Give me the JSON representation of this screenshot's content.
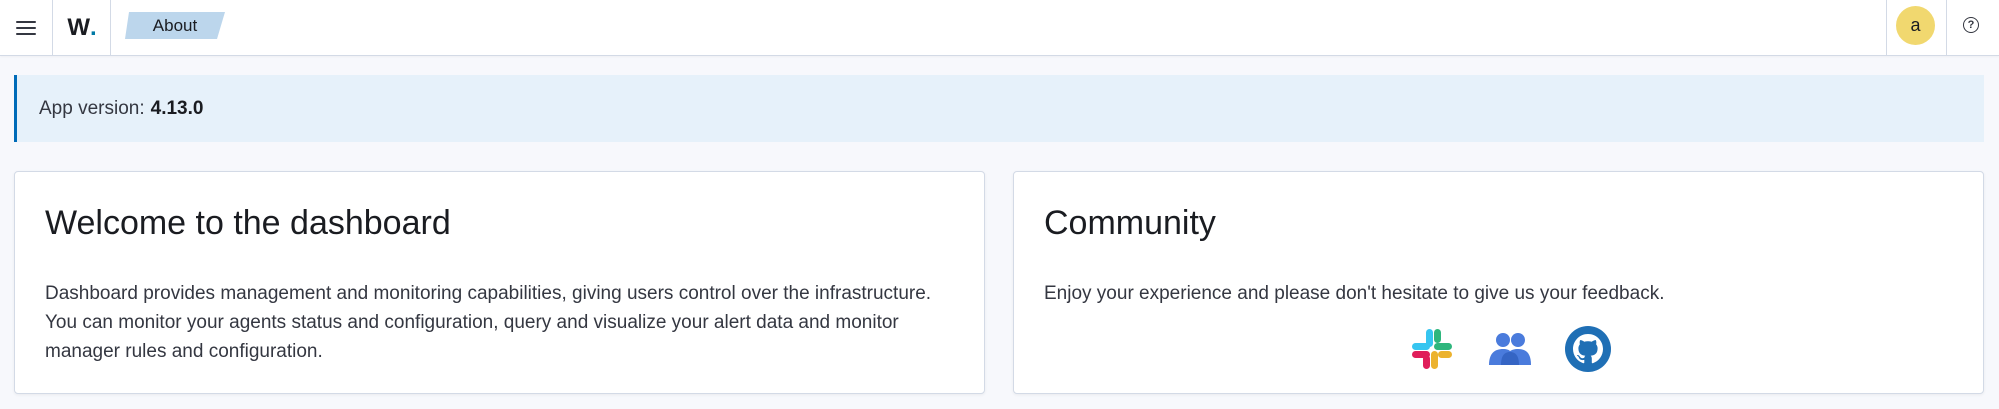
{
  "header": {
    "logo_text": "W",
    "logo_dot": ".",
    "breadcrumb": "About",
    "avatar_initial": "a",
    "help_glyph": "?"
  },
  "version": {
    "label": "App version:",
    "value": "4.13.0"
  },
  "welcome": {
    "title": "Welcome to the dashboard",
    "text": "Dashboard provides management and monitoring capabilities, giving users control over the infrastructure. You can monitor your agents status and configuration, query and visualize your alert data and monitor manager rules and configuration."
  },
  "community": {
    "title": "Community",
    "text": "Enjoy your experience and please don't hesitate to give us your feedback.",
    "icons": [
      "slack-icon",
      "users-group-icon",
      "github-icon"
    ]
  },
  "colors": {
    "accent": "#006bb8",
    "callout_bg": "#e6f1fa",
    "breadcrumb_bg": "#bcd6ec",
    "avatar_bg": "#f1d86f",
    "people_icon": "#4a7bdc",
    "github_icon": "#1f6fb5"
  }
}
